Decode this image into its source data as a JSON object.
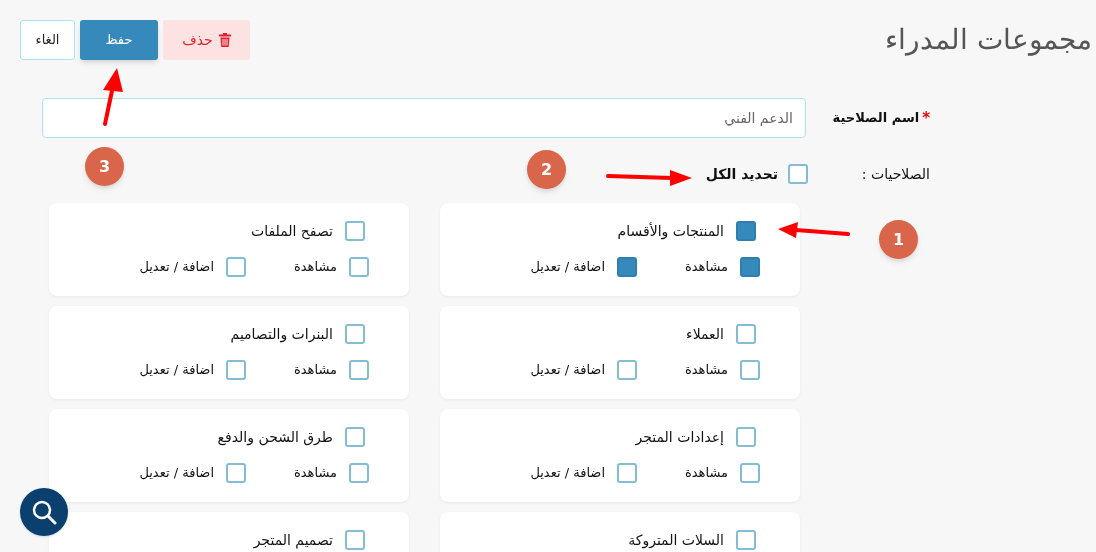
{
  "header": {
    "title": "مجموعات المدراء",
    "buttons": [
      {
        "kind": "delete",
        "label": "حذف"
      },
      {
        "kind": "save",
        "label": "حفظ"
      },
      {
        "kind": "cancel",
        "label": "الغاء"
      }
    ]
  },
  "form": {
    "name_field": {
      "label": "اسم الصلاحية",
      "required_mark": "*",
      "value": "الدعم الفني"
    },
    "permissions": {
      "label": "الصلاحيات :",
      "select_all": {
        "label": "تحديد الكل",
        "checked": false
      }
    }
  },
  "permission_groups": [
    {
      "title": "المنتجات والأقسام",
      "checked": true,
      "options": [
        {
          "label": "مشاهدة",
          "checked": true
        },
        {
          "label": "اضافة / تعديل",
          "checked": true
        }
      ]
    },
    {
      "title": "تصفح الملفات",
      "checked": false,
      "options": [
        {
          "label": "مشاهدة",
          "checked": false
        },
        {
          "label": "اضافة / تعديل",
          "checked": false
        }
      ]
    },
    {
      "title": "العملاء",
      "checked": false,
      "options": [
        {
          "label": "مشاهدة",
          "checked": false
        },
        {
          "label": "اضافة / تعديل",
          "checked": false
        }
      ]
    },
    {
      "title": "البنرات والتصاميم",
      "checked": false,
      "options": [
        {
          "label": "مشاهدة",
          "checked": false
        },
        {
          "label": "اضافة / تعديل",
          "checked": false
        }
      ]
    },
    {
      "title": "إعدادات المتجر",
      "checked": false,
      "options": [
        {
          "label": "مشاهدة",
          "checked": false
        },
        {
          "label": "اضافة / تعديل",
          "checked": false
        }
      ]
    },
    {
      "title": "طرق الشحن والدفع",
      "checked": false,
      "options": [
        {
          "label": "مشاهدة",
          "checked": false
        },
        {
          "label": "اضافة / تعديل",
          "checked": false
        }
      ]
    },
    {
      "title": "السلات المتروكة",
      "checked": false
    },
    {
      "title": "تصميم المتجر",
      "checked": false
    }
  ],
  "annotations": [
    {
      "number": "1"
    },
    {
      "number": "2"
    },
    {
      "number": "3"
    }
  ]
}
